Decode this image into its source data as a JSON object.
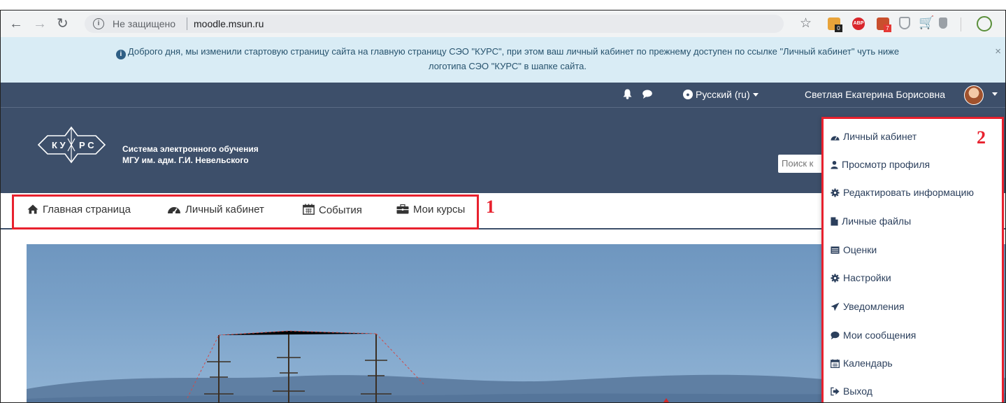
{
  "browser": {
    "security_label": "Не защищено",
    "url": "moodle.msun.ru"
  },
  "notice": {
    "line1": "Доброго дня, мы изменили стартовую страницу сайта на главную страницу СЭО \"КУРС\", при этом ваш личный кабинет по прежнему доступен по ссылке \"Личный кабинет\" чуть ниже",
    "line2": "логотипа СЭО \"КУРС\" в шапке сайта.",
    "close": "×"
  },
  "topbar": {
    "language": "Русский (ru)",
    "user_name": "Светлая Екатерина Борисовна"
  },
  "header": {
    "logo_text": "КУРС",
    "site_title_line1": "Система электронного обучения",
    "site_title_line2": "МГУ им. адм. Г.И. Невельского",
    "search_placeholder": "Поиск к"
  },
  "mainnav": {
    "items": [
      {
        "label": "Главная страница",
        "icon": "home-icon"
      },
      {
        "label": "Личный кабинет",
        "icon": "dashboard-icon"
      },
      {
        "label": "События",
        "icon": "calendar-icon"
      },
      {
        "label": "Мои курсы",
        "icon": "briefcase-icon"
      }
    ]
  },
  "user_menu": {
    "items": [
      {
        "label": "Личный кабинет",
        "icon": "dashboard-icon"
      },
      {
        "label": "Просмотр профиля",
        "icon": "user-icon"
      },
      {
        "label": "Редактировать информацию",
        "icon": "cog-icon"
      },
      {
        "label": "Личные файлы",
        "icon": "file-icon"
      },
      {
        "label": "Оценки",
        "icon": "table-icon"
      },
      {
        "label": "Настройки",
        "icon": "cog-icon"
      },
      {
        "label": "Уведомления",
        "icon": "paper-plane-icon"
      },
      {
        "label": "Мои сообщения",
        "icon": "comment-icon"
      },
      {
        "label": "Календарь",
        "icon": "calendar-icon"
      },
      {
        "label": "Выход",
        "icon": "sign-out-icon"
      }
    ]
  },
  "annotations": {
    "label1": "1",
    "label2": "2"
  },
  "colors": {
    "navbar": "#3d4f6a",
    "annotation_red": "#e8212e",
    "notice_bg": "#d9ecf5"
  }
}
